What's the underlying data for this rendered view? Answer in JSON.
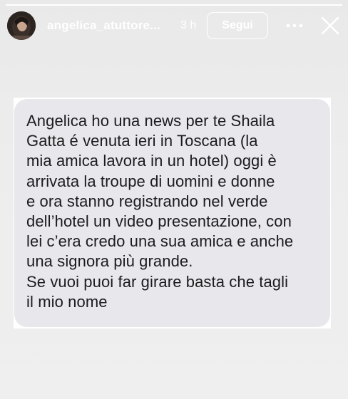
{
  "story": {
    "progress": 1.0,
    "header": {
      "username": "angelica_atuttore...",
      "time": "3 h",
      "follow_label": "Segui",
      "more_icon": "ellipsis-horizontal-icon",
      "close_icon": "close-icon"
    },
    "message": {
      "text": "Angelica ho una news per te Shaila\nGatta é venuta ieri in Toscana (la\nmia amica lavora in un hotel) oggi è\narrivata la troupe di uomini e donne\ne ora stanno registrando nel verde\ndell’hotel un video presentazione, con\nlei c’era credo una sua amica e anche\nuna signora più grande.\nSe vuoi puoi far girare basta che tagli\nil mio nome"
    }
  },
  "colors": {
    "background": "#ececec",
    "header_text": "#ffffff",
    "bubble": "#e7e7ec",
    "message_text": "#1c1c1e"
  }
}
